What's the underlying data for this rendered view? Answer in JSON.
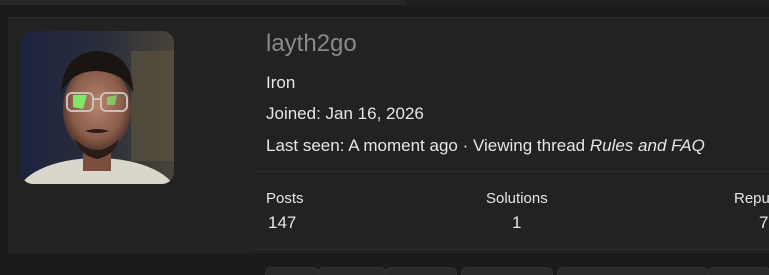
{
  "profile": {
    "username": "layth2go",
    "rank": "Iron",
    "joined": "Joined: Jan 16, 2026",
    "last_seen_prefix": "Last seen: A moment ago · Viewing thread ",
    "last_seen_thread": "Rules and FAQ"
  },
  "stats": [
    {
      "label": "Posts",
      "value": "147"
    },
    {
      "label": "Solutions",
      "value": "1"
    },
    {
      "label": "Repu",
      "value": "7"
    }
  ]
}
